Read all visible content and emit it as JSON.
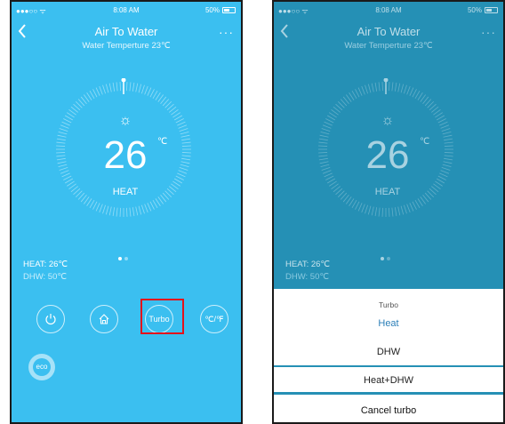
{
  "screens": [
    {
      "status": {
        "time": "8:08 AM",
        "battery": "50%",
        "signal": "●●●○○ ᯤ"
      },
      "header": {
        "title": "Air To Water",
        "subtitle": "Water Temperture 23℃",
        "more": "···"
      },
      "dial": {
        "temperature": "26",
        "unit": "℃",
        "mode": "HEAT"
      },
      "info": {
        "heat": "HEAT: 26℃",
        "dhw": "DHW: 50℃"
      },
      "buttons": {
        "turbo_label": "Turbo",
        "unit_label": "℃/℉",
        "eco_label": "eco"
      }
    },
    {
      "status": {
        "time": "8:08 AM",
        "battery": "50%",
        "signal": "●●●○○ ᯤ"
      },
      "header": {
        "title": "Air To Water",
        "subtitle": "Water Temperture 23℃",
        "more": "···"
      },
      "dial": {
        "temperature": "26",
        "unit": "℃",
        "mode": "HEAT"
      },
      "info": {
        "heat": "HEAT: 26℃",
        "dhw": "DHW: 50℃"
      },
      "sheet": {
        "title": "Turbo",
        "options": [
          "Heat",
          "DHW",
          "Heat+DHW"
        ],
        "cancel": "Cancel turbo",
        "selected_color": "#2c7fb8"
      }
    }
  ],
  "colors": {
    "left_bg": "#3bbff0",
    "right_bg": "#2590b5",
    "highlight": "#e4121b"
  }
}
